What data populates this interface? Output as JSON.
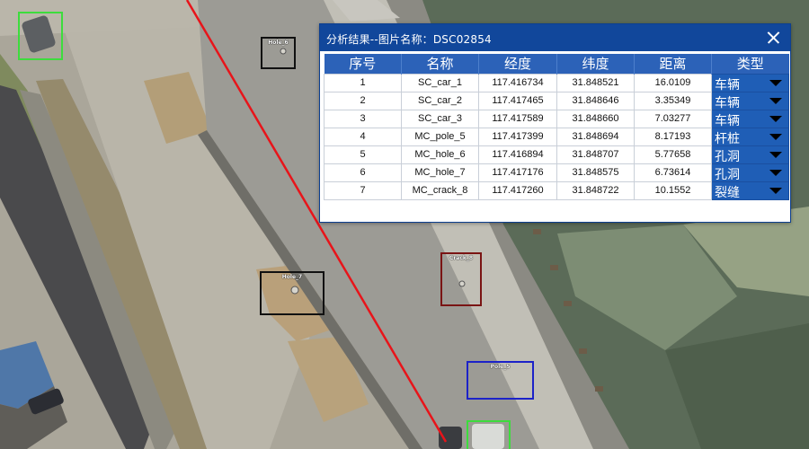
{
  "dialog": {
    "title": "分析结果--图片名称：DSC02854",
    "columns": [
      "序号",
      "名称",
      "经度",
      "纬度",
      "距离",
      "类型"
    ],
    "rows": [
      {
        "index": "1",
        "name": "SC_car_1",
        "lon": "117.416734",
        "lat": "31.848521",
        "dist": "16.0109",
        "type": "车辆"
      },
      {
        "index": "2",
        "name": "SC_car_2",
        "lon": "117.417465",
        "lat": "31.848646",
        "dist": "3.35349",
        "type": "车辆"
      },
      {
        "index": "3",
        "name": "SC_car_3",
        "lon": "117.417589",
        "lat": "31.848660",
        "dist": "7.03277",
        "type": "车辆"
      },
      {
        "index": "4",
        "name": "MC_pole_5",
        "lon": "117.417399",
        "lat": "31.848694",
        "dist": "8.17193",
        "type": "杆桩"
      },
      {
        "index": "5",
        "name": "MC_hole_6",
        "lon": "117.416894",
        "lat": "31.848707",
        "dist": "5.77658",
        "type": "孔洞"
      },
      {
        "index": "6",
        "name": "MC_hole_7",
        "lon": "117.417176",
        "lat": "31.848575",
        "dist": "6.73614",
        "type": "孔洞"
      },
      {
        "index": "7",
        "name": "MC_crack_8",
        "lon": "117.417260",
        "lat": "31.848722",
        "dist": "10.1552",
        "type": "裂缝"
      }
    ]
  },
  "detections": [
    {
      "id": "car-1",
      "label": "",
      "color": "#3ddc3d"
    },
    {
      "id": "hole-6",
      "label": "Hole_6",
      "color": "#111111"
    },
    {
      "id": "hole-7",
      "label": "Hole_7",
      "color": "#111111"
    },
    {
      "id": "crack-8",
      "label": "Crack_8",
      "color": "#7a1414"
    },
    {
      "id": "pole-5",
      "label": "Pole_5",
      "color": "#1c22c8"
    },
    {
      "id": "car-2",
      "label": "",
      "color": "#3ddc3d"
    }
  ],
  "colors": {
    "track_line": "#e8141a",
    "title_bar": "#11479b",
    "header_bg": "#2c62b8",
    "type_cell": "#1f5eb6"
  },
  "icons": {
    "close": "close-icon",
    "dropdown": "chevron-down-icon"
  }
}
